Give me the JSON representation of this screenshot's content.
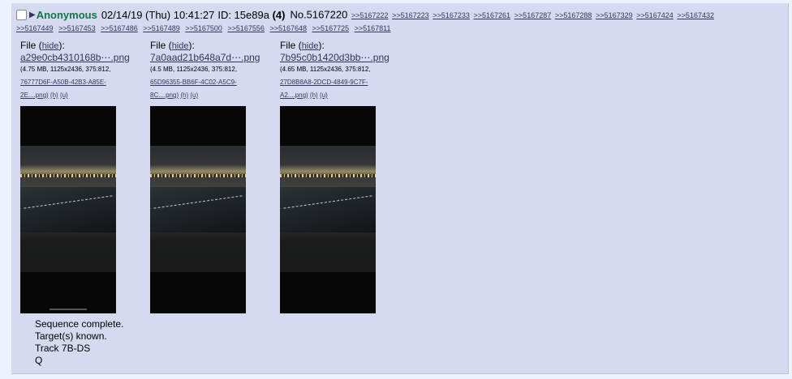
{
  "post": {
    "name": "Anonymous",
    "datetime": "02/14/19 (Thu) 10:41:27",
    "id_label": "ID: 15e89a",
    "id_count": "(4)",
    "number": "No.5167220",
    "replies": [
      ">>5167222",
      ">>5167223",
      ">>5167233",
      ">>5167261",
      ">>5167287",
      ">>5167288",
      ">>5167329",
      ">>5167424",
      ">>5167432",
      ">>5167449",
      ">>5167453",
      ">>5167486",
      ">>5167489",
      ">>5167500",
      ">>5167556",
      ">>5167648",
      ">>5167725",
      ">>5167811"
    ],
    "files": [
      {
        "label": "File",
        "hide": "hide",
        "filename": "a29e0cb4310168b⋯.png",
        "info_line1": "(4.75 MB, 1125x2436, 375:812,",
        "info_link": "76777D6F-A50B-42B3-A85E-",
        "info_link2": "2E....png)",
        "h": "(h)",
        "u": "(u)"
      },
      {
        "label": "File",
        "hide": "hide",
        "filename": "7a0aad21b648a7d⋯.png",
        "info_line1": "(4.5 MB, 1125x2436, 375:812,",
        "info_link": "65D96355-BB6F-4C02-A5C9-",
        "info_link2": "8C....png)",
        "h": "(h)",
        "u": "(u)"
      },
      {
        "label": "File",
        "hide": "hide",
        "filename": "7b95c0b1420d3bb⋯.png",
        "info_line1": "(4.65 MB, 1125x2436, 375:812,",
        "info_link": "27D8B8A8-2DCD-4849-9C7F-",
        "info_link2": "A2....png)",
        "h": "(h)",
        "u": "(u)"
      }
    ],
    "comment": [
      "Sequence complete.",
      "Target(s) known.",
      "Track 7B-DS",
      "Q"
    ]
  }
}
